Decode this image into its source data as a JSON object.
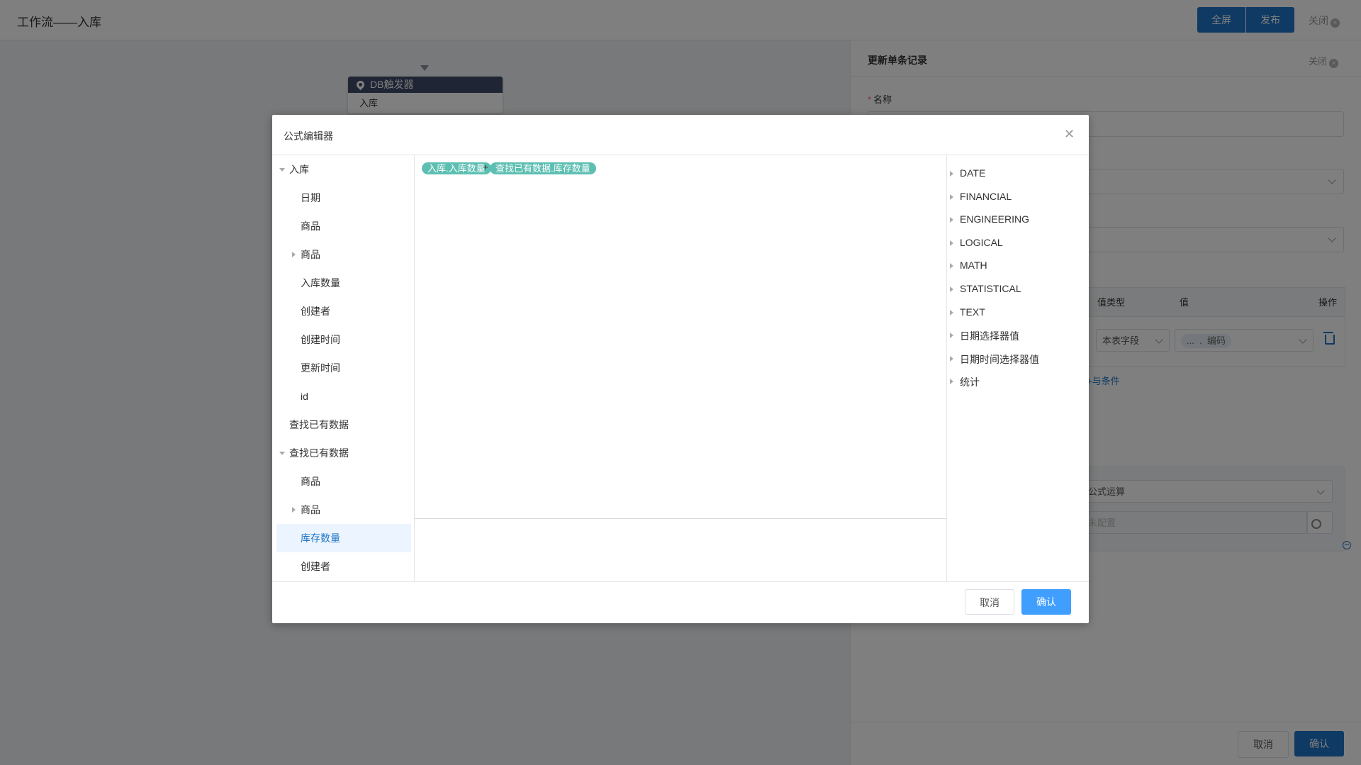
{
  "app": {
    "title": "工作流——入库"
  },
  "toolbar": {
    "fullscreen_label": "全屏",
    "publish_label": "发布",
    "close_label": "关闭"
  },
  "canvas": {
    "node": {
      "title": "DB触发器",
      "subtitle": "入库"
    }
  },
  "right_panel": {
    "title": "更新单条记录",
    "close_label": "关闭",
    "name_label": "名称",
    "table_headers": {
      "value_type": "值类型",
      "value": "值",
      "action": "操作"
    },
    "condition_row": {
      "value_type": "本表字段",
      "value_prefix": "...",
      "value_sep": ".",
      "value_field": "编码"
    },
    "add_condition": "+与条件",
    "formula_type": "公式运算",
    "formula_value": "未配置",
    "cancel_label": "取消",
    "confirm_label": "确认"
  },
  "dialog": {
    "title": "公式编辑器",
    "tree": [
      {
        "label": "入库",
        "level": 0,
        "expanded": true
      },
      {
        "label": "日期",
        "level": 1
      },
      {
        "label": "商品",
        "level": 1
      },
      {
        "label": "商品",
        "level": 1,
        "collapsed": true
      },
      {
        "label": "入库数量",
        "level": 1
      },
      {
        "label": "创建者",
        "level": 1
      },
      {
        "label": "创建时间",
        "level": 1
      },
      {
        "label": "更新时间",
        "level": 1
      },
      {
        "label": "id",
        "level": 1
      },
      {
        "label": "查找已有数据",
        "level": 0
      },
      {
        "label": "查找已有数据",
        "level": 0,
        "expanded": true
      },
      {
        "label": "商品",
        "level": 1
      },
      {
        "label": "商品",
        "level": 1,
        "collapsed": true
      },
      {
        "label": "库存数量",
        "level": 1,
        "selected": true
      },
      {
        "label": "创建者",
        "level": 1
      }
    ],
    "formula": {
      "token1": "入库.入库数量",
      "operator": "+",
      "token2": "查找已有数据.库存数量"
    },
    "functions": [
      "DATE",
      "FINANCIAL",
      "ENGINEERING",
      "LOGICAL",
      "MATH",
      "STATISTICAL",
      "TEXT",
      "日期选择器值",
      "日期时间选择器值",
      "统计"
    ],
    "cancel_label": "取消",
    "confirm_label": "确认"
  },
  "colors": {
    "primary": "#1f74c6",
    "dialog_primary": "#409eff",
    "chip": "#5dbfb2",
    "node_header": "#3f4a6b"
  }
}
